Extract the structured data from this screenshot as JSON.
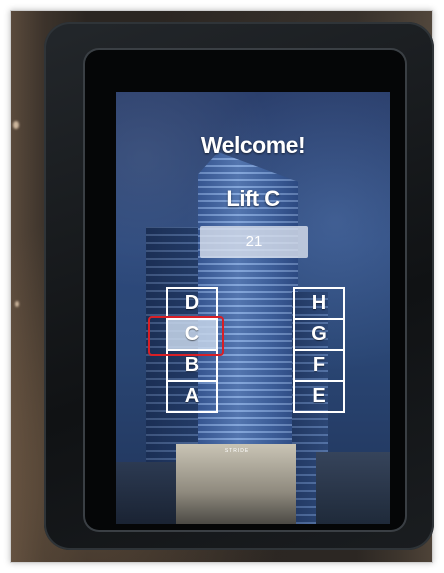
{
  "screen": {
    "welcome_text": "Welcome!",
    "lift_title": "Lift C",
    "floor_number": "21"
  },
  "lifts": {
    "left": [
      {
        "label": "D"
      },
      {
        "label": "C",
        "current": true
      },
      {
        "label": "B"
      },
      {
        "label": "A"
      }
    ],
    "right": [
      {
        "label": "H"
      },
      {
        "label": "G"
      },
      {
        "label": "F"
      },
      {
        "label": "E"
      }
    ]
  },
  "building_sign": "STRIDE",
  "colors": {
    "highlight": "#d81f26",
    "screen_blue": "#2e4a7d",
    "text": "#ffffff"
  }
}
